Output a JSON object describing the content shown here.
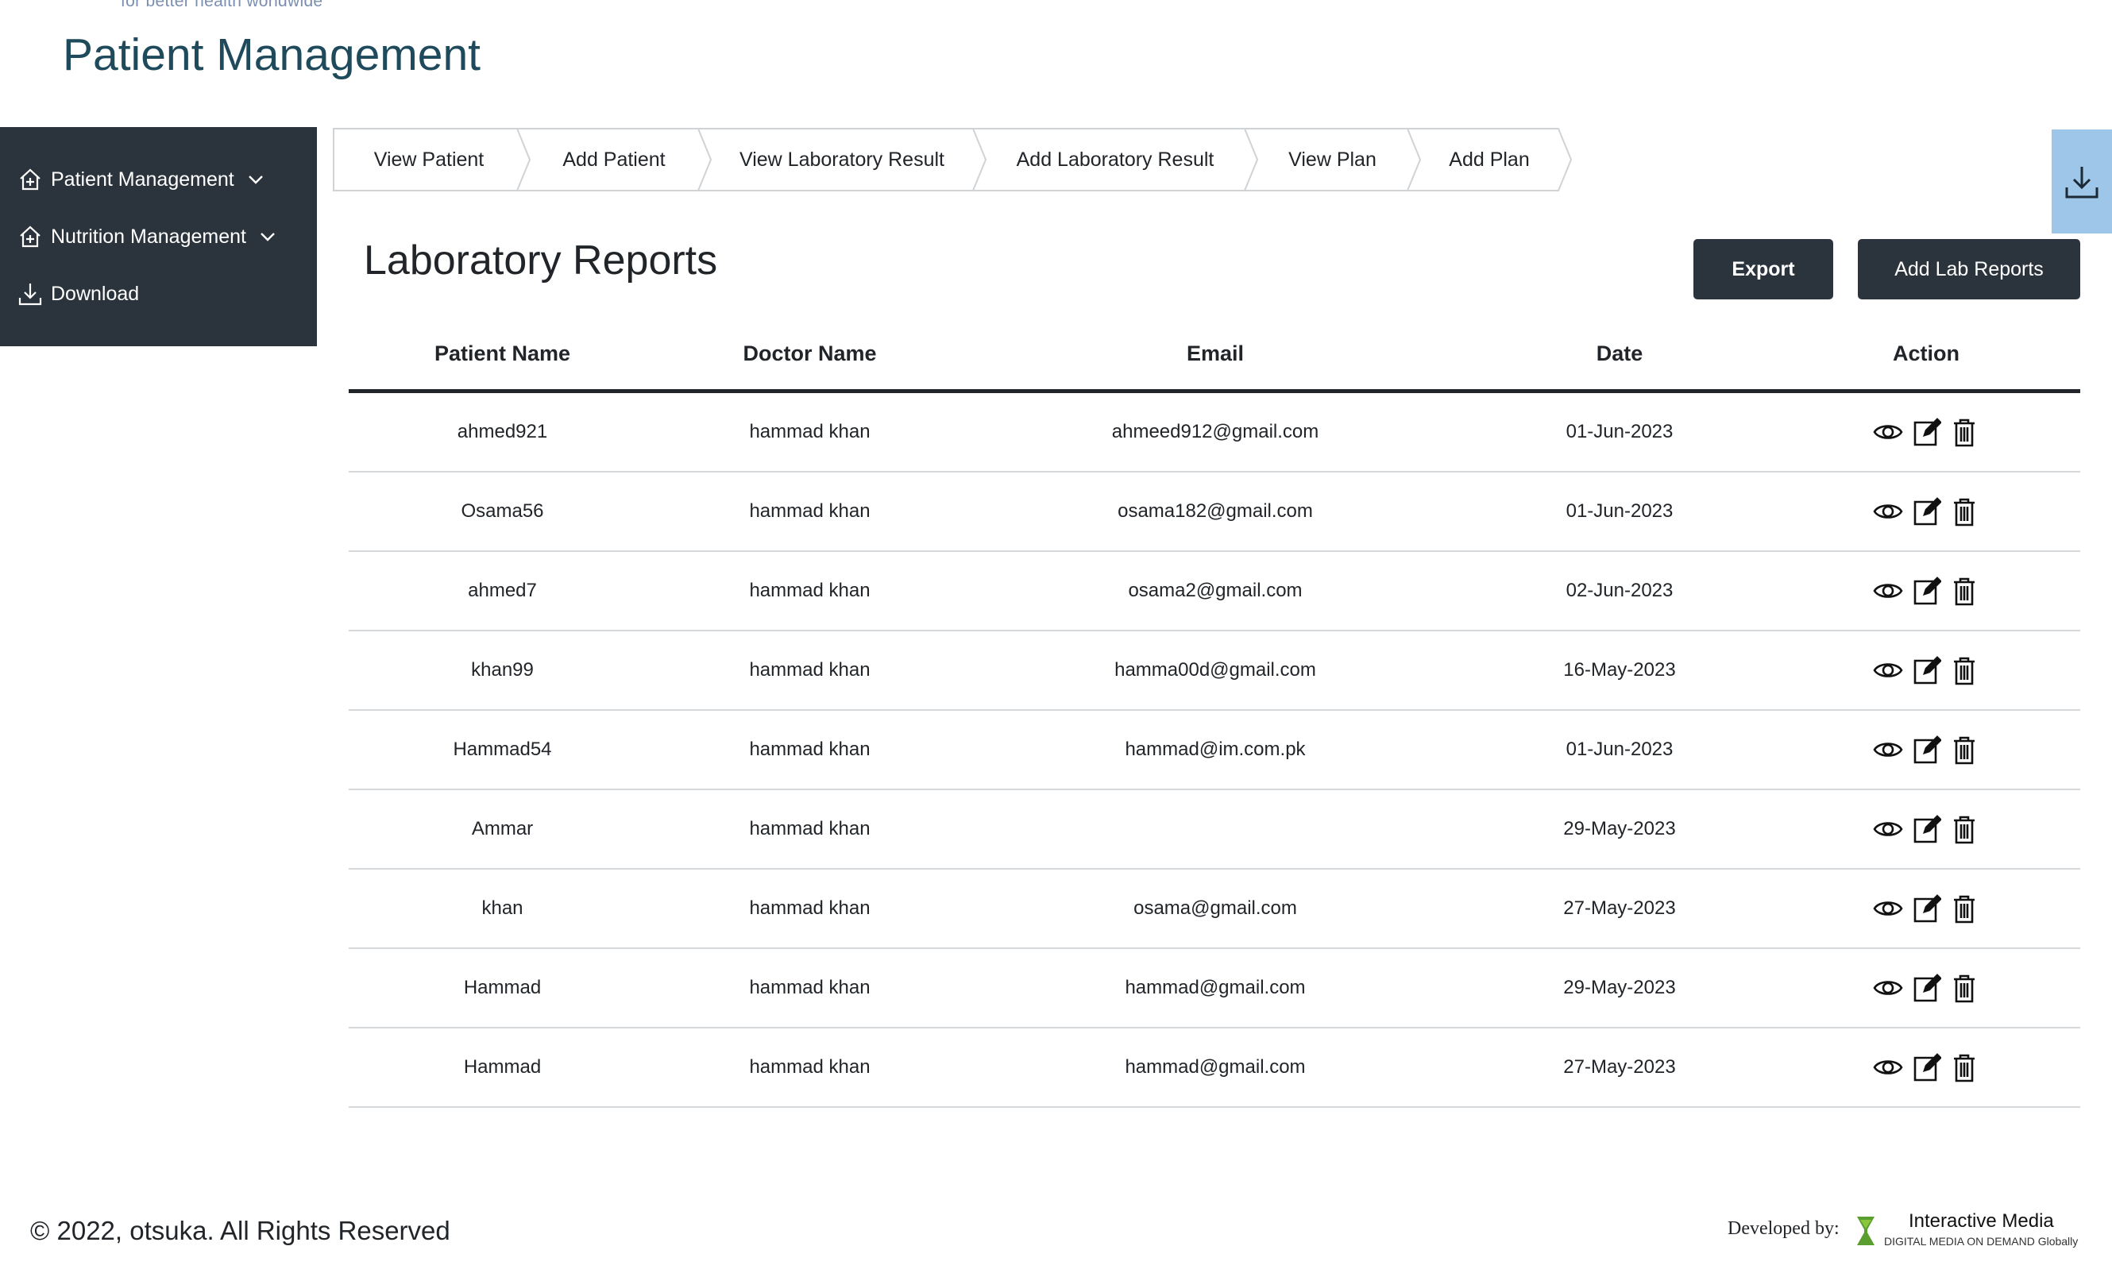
{
  "header": {
    "tagline": "for better health worldwide",
    "title": "Patient Management"
  },
  "sidebar": {
    "items": [
      {
        "label": "Patient Management",
        "icon": "house-plus-icon",
        "expandable": true
      },
      {
        "label": "Nutrition Management",
        "icon": "house-plus-icon",
        "expandable": true
      },
      {
        "label": "Download",
        "icon": "download-icon",
        "expandable": false
      }
    ]
  },
  "breadcrumb": {
    "items": [
      "View Patient",
      "Add Patient",
      "View Laboratory Result",
      "Add Laboratory Result",
      "View Plan",
      "Add Plan"
    ]
  },
  "main": {
    "title": "Laboratory Reports",
    "export_label": "Export",
    "add_label": "Add Lab Reports"
  },
  "table": {
    "columns": [
      "Patient Name",
      "Doctor Name",
      "Email",
      "Date",
      "Action"
    ],
    "rows": [
      {
        "patient": "ahmed921",
        "doctor": "hammad khan",
        "email": "ahmeed912@gmail.com",
        "date": "01-Jun-2023"
      },
      {
        "patient": "Osama56",
        "doctor": "hammad khan",
        "email": "osama182@gmail.com",
        "date": "01-Jun-2023"
      },
      {
        "patient": "ahmed7",
        "doctor": "hammad khan",
        "email": "osama2@gmail.com",
        "date": "02-Jun-2023"
      },
      {
        "patient": "khan99",
        "doctor": "hammad khan",
        "email": "hamma00d@gmail.com",
        "date": "16-May-2023"
      },
      {
        "patient": "Hammad54",
        "doctor": "hammad khan",
        "email": "hammad@im.com.pk",
        "date": "01-Jun-2023"
      },
      {
        "patient": "Ammar",
        "doctor": "hammad khan",
        "email": "",
        "date": "29-May-2023"
      },
      {
        "patient": "khan",
        "doctor": "hammad khan",
        "email": "osama@gmail.com",
        "date": "27-May-2023"
      },
      {
        "patient": "Hammad",
        "doctor": "hammad khan",
        "email": "hammad@gmail.com",
        "date": "29-May-2023"
      },
      {
        "patient": "Hammad",
        "doctor": "hammad khan",
        "email": "hammad@gmail.com",
        "date": "27-May-2023"
      }
    ],
    "row_actions": [
      "eye-icon",
      "edit-icon",
      "trash-icon"
    ]
  },
  "footer": {
    "copyright": "© 2022, otsuka. All Rights Reserved",
    "developed_by": "Developed by:",
    "company": "Interactive Media",
    "company_tagline": "DIGITAL MEDIA ON DEMAND Globally"
  },
  "colors": {
    "sidebar_bg": "#2b343c",
    "title": "#1e4a5c",
    "download_fab": "#9ec6e8",
    "button_dark": "#2b343c"
  }
}
